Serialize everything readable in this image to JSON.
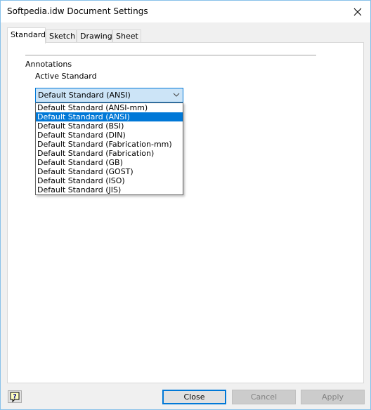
{
  "window": {
    "title": "Softpedia.idw Document Settings"
  },
  "tabs": [
    {
      "label": "Standard",
      "active": true
    },
    {
      "label": "Sketch",
      "active": false
    },
    {
      "label": "Drawing",
      "active": false
    },
    {
      "label": "Sheet",
      "active": false
    }
  ],
  "standard_tab": {
    "group_label": "Annotations",
    "field_label": "Active Standard",
    "combo_value": "Default Standard (ANSI)",
    "options": [
      {
        "label": "Default Standard (ANSI-mm)",
        "selected": false
      },
      {
        "label": "Default Standard (ANSI)",
        "selected": true
      },
      {
        "label": "Default Standard (BSI)",
        "selected": false
      },
      {
        "label": "Default Standard (DIN)",
        "selected": false
      },
      {
        "label": "Default Standard (Fabrication-mm)",
        "selected": false
      },
      {
        "label": "Default Standard (Fabrication)",
        "selected": false
      },
      {
        "label": "Default Standard (GB)",
        "selected": false
      },
      {
        "label": "Default Standard (GOST)",
        "selected": false
      },
      {
        "label": "Default Standard (ISO)",
        "selected": false
      },
      {
        "label": "Default Standard (JIS)",
        "selected": false
      }
    ]
  },
  "footer": {
    "help_icon": "help-question-icon",
    "close_label": "Close",
    "cancel_label": "Cancel",
    "apply_label": "Apply",
    "cancel_enabled": false,
    "apply_enabled": false
  },
  "colors": {
    "accent": "#0078d7",
    "selection_bg": "#cce4f7",
    "window_border": "#88c1ea"
  }
}
